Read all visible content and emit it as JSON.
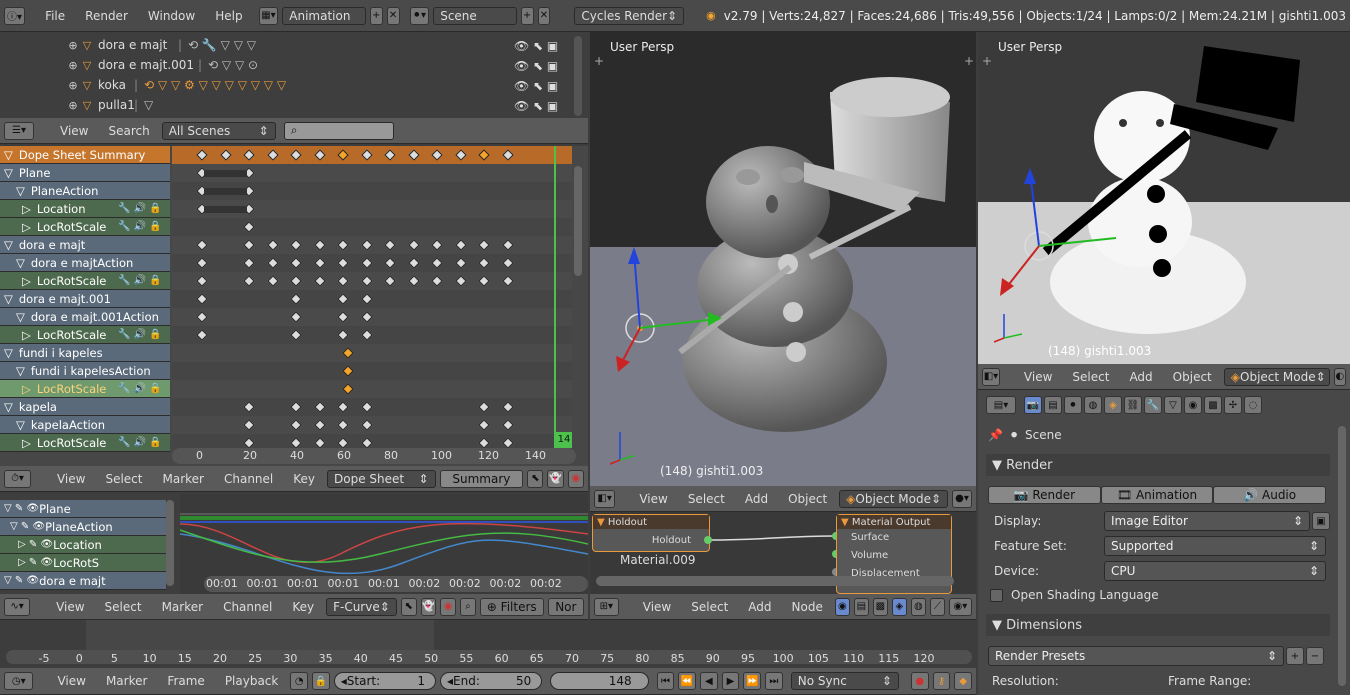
{
  "top_bar": {
    "menus": [
      "File",
      "Render",
      "Window",
      "Help"
    ],
    "screen_layout": "Animation",
    "scene": "Scene",
    "render_engine": "Cycles Render",
    "stats": "v2.79 | Verts:24,827 | Faces:24,686 | Tris:49,556 | Objects:1/24 | Lamps:0/2 | Mem:24.21M | gishti1.003"
  },
  "outliner": {
    "items": [
      {
        "label": "dora e majt"
      },
      {
        "label": "dora e majt.001"
      },
      {
        "label": "koka"
      },
      {
        "label": "pulla1"
      }
    ],
    "header": {
      "view": "View",
      "search": "Search",
      "filter": "All Scenes"
    }
  },
  "dopesheet": {
    "channels": [
      {
        "label": "Dope Sheet Summary",
        "kind": "sum"
      },
      {
        "label": "Plane",
        "kind": "obj"
      },
      {
        "label": "PlaneAction",
        "kind": "act"
      },
      {
        "label": "Location",
        "kind": "fc"
      },
      {
        "label": "LocRotScale",
        "kind": "fc"
      },
      {
        "label": "dora e majt",
        "kind": "obj"
      },
      {
        "label": "dora e majtAction",
        "kind": "act"
      },
      {
        "label": "LocRotScale",
        "kind": "fc"
      },
      {
        "label": "dora e majt.001",
        "kind": "obj"
      },
      {
        "label": "dora e majt.001Action",
        "kind": "act"
      },
      {
        "label": "LocRotScale",
        "kind": "fc"
      },
      {
        "label": "fundi i kapeles",
        "kind": "obj"
      },
      {
        "label": "fundi i kapelesAction",
        "kind": "act"
      },
      {
        "label": "LocRotScale",
        "kind": "sel"
      },
      {
        "label": "kapela",
        "kind": "obj"
      },
      {
        "label": "kapelaAction",
        "kind": "act"
      },
      {
        "label": "LocRotScale",
        "kind": "fc"
      }
    ],
    "ruler": [
      "0",
      "20",
      "40",
      "60",
      "80",
      "100",
      "120",
      "140"
    ],
    "current_frame_badge": "14",
    "header": {
      "view": "View",
      "select": "Select",
      "marker": "Marker",
      "channel": "Channel",
      "key": "Key",
      "mode": "Dope Sheet",
      "summary": "Summary"
    }
  },
  "graph_editor": {
    "channels": [
      {
        "label": "Plane"
      },
      {
        "label": "PlaneAction"
      },
      {
        "label": "Location"
      },
      {
        "label": "LocRotS"
      },
      {
        "label": "dora e majt"
      }
    ],
    "ruler": [
      "00:01",
      "00:01",
      "00:01",
      "00:01",
      "00:01",
      "00:02",
      "00:02",
      "00:02",
      "00:02"
    ],
    "header": {
      "view": "View",
      "select": "Select",
      "marker": "Marker",
      "channel": "Channel",
      "key": "Key",
      "mode": "F-Curve",
      "filters": "Filters",
      "normalize": "Nor"
    }
  },
  "viewport_left": {
    "label": "User Persp",
    "object_label": "(148) gishti1.003",
    "header": {
      "view": "View",
      "select": "Select",
      "add": "Add",
      "object": "Object",
      "mode": "Object Mode"
    }
  },
  "node_editor": {
    "node_left": "Holdout",
    "node_left_socket": "Holdout",
    "node_right": "Material Output",
    "sockets": [
      "Surface",
      "Volume",
      "Displacement"
    ],
    "material": "Material.009",
    "header": {
      "view": "View",
      "select": "Select",
      "add": "Add",
      "node": "Node"
    }
  },
  "viewport_right": {
    "label": "User Persp",
    "object_label": "(148) gishti1.003",
    "header": {
      "view": "View",
      "select": "Select",
      "add": "Add",
      "object": "Object",
      "mode": "Object Mode"
    }
  },
  "properties": {
    "scene_crumb": "Scene",
    "render_section": "Render",
    "render_buttons": [
      "Render",
      "Animation",
      "Audio"
    ],
    "display_label": "Display:",
    "display_value": "Image Editor",
    "feature_label": "Feature Set:",
    "feature_value": "Supported",
    "device_label": "Device:",
    "device_value": "CPU",
    "osl_label": "Open Shading Language",
    "dimensions_section": "Dimensions",
    "presets": "Render Presets",
    "resolution_label": "Resolution:",
    "frame_range_label": "Frame Range:"
  },
  "timeline": {
    "ruler": [
      "-5",
      "0",
      "5",
      "10",
      "15",
      "20",
      "25",
      "30",
      "35",
      "40",
      "45",
      "50",
      "55",
      "60",
      "65",
      "70",
      "75",
      "80",
      "85",
      "90",
      "95",
      "100",
      "105",
      "110",
      "115",
      "120"
    ],
    "menus": [
      "View",
      "Marker",
      "Frame",
      "Playback"
    ],
    "start_label": "Start:",
    "start_value": "1",
    "end_label": "End:",
    "end_value": "50",
    "current": "148",
    "sync": "No Sync"
  }
}
